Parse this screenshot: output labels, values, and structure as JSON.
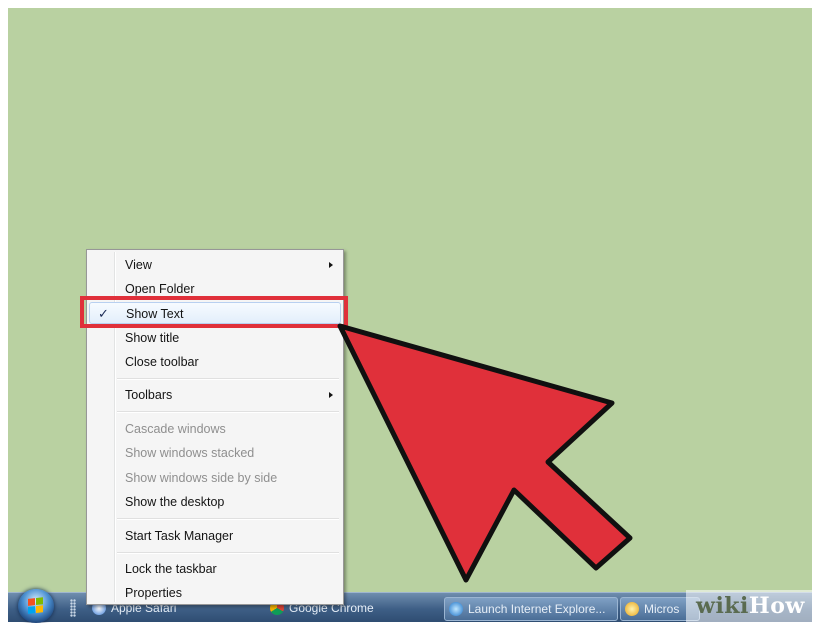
{
  "colors": {
    "desktop": "#b9d1a1",
    "annotation_red": "#e0303a",
    "taskbar": "#3e5f86",
    "menu_background": "#f5f5f5"
  },
  "context_menu": {
    "items": [
      {
        "label": "View",
        "submenu": true,
        "enabled": true,
        "checked": false
      },
      {
        "label": "Open Folder",
        "submenu": false,
        "enabled": true,
        "checked": false
      },
      {
        "label": "Show Text",
        "submenu": false,
        "enabled": true,
        "checked": true,
        "highlighted": true
      },
      {
        "label": "Show title",
        "submenu": false,
        "enabled": true,
        "checked": false
      },
      {
        "label": "Close toolbar",
        "submenu": false,
        "enabled": true,
        "checked": false
      },
      {
        "label": "Toolbars",
        "submenu": true,
        "enabled": true,
        "checked": false
      },
      {
        "label": "Cascade windows",
        "submenu": false,
        "enabled": false,
        "checked": false
      },
      {
        "label": "Show windows stacked",
        "submenu": false,
        "enabled": false,
        "checked": false
      },
      {
        "label": "Show windows side by side",
        "submenu": false,
        "enabled": false,
        "checked": false
      },
      {
        "label": "Show the desktop",
        "submenu": false,
        "enabled": true,
        "checked": false
      },
      {
        "label": "Start Task Manager",
        "submenu": false,
        "enabled": true,
        "checked": false
      },
      {
        "label": "Lock the taskbar",
        "submenu": false,
        "enabled": true,
        "checked": false
      },
      {
        "label": "Properties",
        "submenu": false,
        "enabled": true,
        "checked": false
      }
    ],
    "check_mark": "✓"
  },
  "taskbar": {
    "buttons": [
      {
        "label": "Apple Safari",
        "icon": "safari-icon"
      },
      {
        "label": "Google Chrome",
        "icon": "chrome-icon"
      },
      {
        "label": "Launch Internet Explore...",
        "icon": "internet-explorer-icon"
      },
      {
        "label": "Micros",
        "icon": "microsoft-icon"
      }
    ]
  },
  "watermark": {
    "part1": "wiki",
    "part2": "How"
  }
}
